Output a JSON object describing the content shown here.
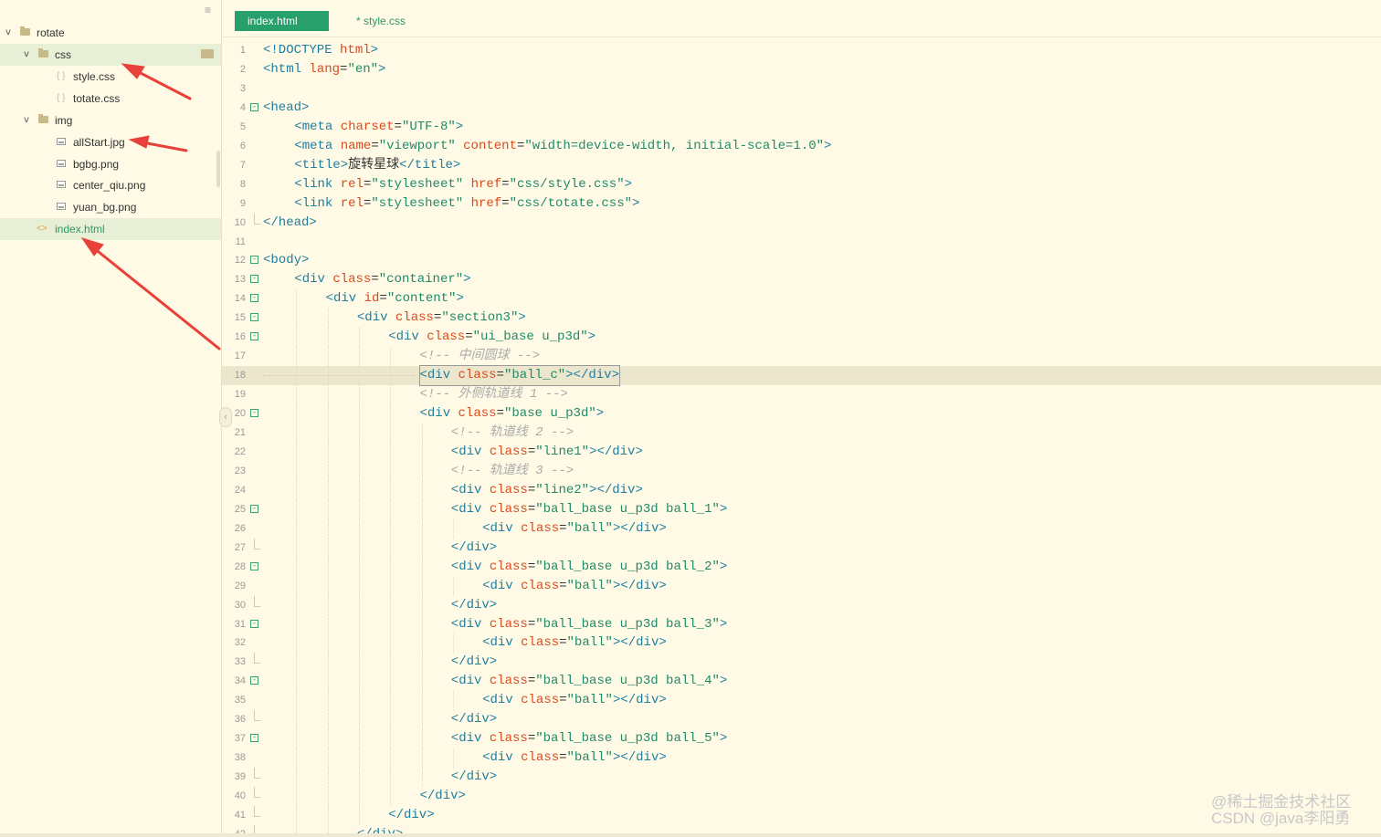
{
  "sidebar": {
    "items": [
      {
        "label": "rotate",
        "kind": "folder",
        "expanded": true
      },
      {
        "label": "css",
        "kind": "folder",
        "expanded": true,
        "selected": true
      },
      {
        "label": "style.css",
        "kind": "css-file"
      },
      {
        "label": "totate.css",
        "kind": "css-file"
      },
      {
        "label": "img",
        "kind": "folder",
        "expanded": true
      },
      {
        "label": "allStart.jpg",
        "kind": "image-file"
      },
      {
        "label": "bgbg.png",
        "kind": "image-file"
      },
      {
        "label": "center_qiu.png",
        "kind": "image-file"
      },
      {
        "label": "yuan_bg.png",
        "kind": "image-file"
      },
      {
        "label": "index.html",
        "kind": "html-file",
        "active": true
      }
    ]
  },
  "tabs": [
    {
      "label": "index.html",
      "active": true
    },
    {
      "label": "* style.css",
      "active": false
    }
  ],
  "editor": {
    "current_line": 18,
    "lines": [
      {
        "n": "1",
        "code": [
          [
            "t",
            "<!DOCTYPE "
          ],
          [
            "a",
            "html"
          ],
          [
            "t",
            ">"
          ]
        ]
      },
      {
        "n": "2",
        "code": [
          [
            "t",
            "<html "
          ],
          [
            "a",
            "lang"
          ],
          [
            "p",
            "="
          ],
          [
            "s",
            "\"en\""
          ],
          [
            "t",
            ">"
          ]
        ]
      },
      {
        "n": "3",
        "code": []
      },
      {
        "n": "4",
        "fold": true,
        "code": [
          [
            "t",
            "<head>"
          ]
        ]
      },
      {
        "n": "5",
        "code": [
          [
            "t",
            "<meta "
          ],
          [
            "a",
            "charset"
          ],
          [
            "p",
            "="
          ],
          [
            "s",
            "\"UTF-8\""
          ],
          [
            "t",
            ">"
          ]
        ]
      },
      {
        "n": "6",
        "code": [
          [
            "t",
            "<meta "
          ],
          [
            "a",
            "name"
          ],
          [
            "p",
            "="
          ],
          [
            "s",
            "\"viewport\" "
          ],
          [
            "a",
            "content"
          ],
          [
            "p",
            "="
          ],
          [
            "s",
            "\"width=device-width, initial-scale=1.0\""
          ],
          [
            "t",
            ">"
          ]
        ]
      },
      {
        "n": "7",
        "code": [
          [
            "t",
            "<title>"
          ],
          [
            "p",
            "旋转星球"
          ],
          [
            "t",
            "</title>"
          ]
        ]
      },
      {
        "n": "8",
        "code": [
          [
            "t",
            "<link "
          ],
          [
            "a",
            "rel"
          ],
          [
            "p",
            "="
          ],
          [
            "s",
            "\"stylesheet\" "
          ],
          [
            "a",
            "href"
          ],
          [
            "p",
            "="
          ],
          [
            "s",
            "\"css/style.css\""
          ],
          [
            "t",
            ">"
          ]
        ]
      },
      {
        "n": "9",
        "code": [
          [
            "t",
            "<link "
          ],
          [
            "a",
            "rel"
          ],
          [
            "p",
            "="
          ],
          [
            "s",
            "\"stylesheet\" "
          ],
          [
            "a",
            "href"
          ],
          [
            "p",
            "="
          ],
          [
            "s",
            "\"css/totate.css\""
          ],
          [
            "t",
            ">"
          ]
        ]
      },
      {
        "n": "10",
        "foldEnd": true,
        "code": [
          [
            "t",
            "</head>"
          ]
        ]
      },
      {
        "n": "11",
        "code": []
      },
      {
        "n": "12",
        "fold": true,
        "code": [
          [
            "t",
            "<body>"
          ]
        ]
      },
      {
        "n": "13",
        "fold": true,
        "code": [
          [
            "t",
            "<div "
          ],
          [
            "a",
            "class"
          ],
          [
            "p",
            "="
          ],
          [
            "s",
            "\"container\""
          ],
          [
            "t",
            ">"
          ]
        ]
      },
      {
        "n": "14",
        "fold": true,
        "code": [
          [
            "t",
            "<div "
          ],
          [
            "a",
            "id"
          ],
          [
            "p",
            "="
          ],
          [
            "s",
            "\"content\""
          ],
          [
            "t",
            ">"
          ]
        ]
      },
      {
        "n": "15",
        "fold": true,
        "code": [
          [
            "t",
            "<div "
          ],
          [
            "a",
            "class"
          ],
          [
            "p",
            "="
          ],
          [
            "s",
            "\"section3\""
          ],
          [
            "t",
            ">"
          ]
        ]
      },
      {
        "n": "16",
        "fold": true,
        "code": [
          [
            "t",
            "<div "
          ],
          [
            "a",
            "class"
          ],
          [
            "p",
            "="
          ],
          [
            "s",
            "\"ui_base u_p3d\""
          ],
          [
            "t",
            ">"
          ]
        ]
      },
      {
        "n": "17",
        "code": [
          [
            "c",
            "<!-- 中间圆球 -->"
          ]
        ]
      },
      {
        "n": "18",
        "code": [
          [
            "t",
            "<div "
          ],
          [
            "a",
            "class"
          ],
          [
            "p",
            "="
          ],
          [
            "s",
            "\"ball_c\""
          ],
          [
            "t",
            "></div>"
          ]
        ]
      },
      {
        "n": "19",
        "code": [
          [
            "c",
            "<!-- 外侧轨道线 1 -->"
          ]
        ]
      },
      {
        "n": "20",
        "fold": true,
        "code": [
          [
            "t",
            "<div "
          ],
          [
            "a",
            "class"
          ],
          [
            "p",
            "="
          ],
          [
            "s",
            "\"base u_p3d\""
          ],
          [
            "t",
            ">"
          ]
        ]
      },
      {
        "n": "21",
        "code": [
          [
            "c",
            "<!-- 轨道线 2 -->"
          ]
        ]
      },
      {
        "n": "22",
        "code": [
          [
            "t",
            "<div "
          ],
          [
            "a",
            "class"
          ],
          [
            "p",
            "="
          ],
          [
            "s",
            "\"line1\""
          ],
          [
            "t",
            "></div>"
          ]
        ]
      },
      {
        "n": "23",
        "code": [
          [
            "c",
            "<!-- 轨道线 3 -->"
          ]
        ]
      },
      {
        "n": "24",
        "code": [
          [
            "t",
            "<div "
          ],
          [
            "a",
            "class"
          ],
          [
            "p",
            "="
          ],
          [
            "s",
            "\"line2\""
          ],
          [
            "t",
            "></div>"
          ]
        ]
      },
      {
        "n": "25",
        "fold": true,
        "code": [
          [
            "t",
            "<div "
          ],
          [
            "a",
            "class"
          ],
          [
            "p",
            "="
          ],
          [
            "s",
            "\"ball_base u_p3d ball_1\""
          ],
          [
            "t",
            ">"
          ]
        ]
      },
      {
        "n": "26",
        "code": [
          [
            "t",
            "<div "
          ],
          [
            "a",
            "class"
          ],
          [
            "p",
            "="
          ],
          [
            "s",
            "\"ball\""
          ],
          [
            "t",
            "></div>"
          ]
        ]
      },
      {
        "n": "27",
        "foldEnd": true,
        "code": [
          [
            "t",
            "</div>"
          ]
        ]
      },
      {
        "n": "28",
        "fold": true,
        "code": [
          [
            "t",
            "<div "
          ],
          [
            "a",
            "class"
          ],
          [
            "p",
            "="
          ],
          [
            "s",
            "\"ball_base u_p3d ball_2\""
          ],
          [
            "t",
            ">"
          ]
        ]
      },
      {
        "n": "29",
        "code": [
          [
            "t",
            "<div "
          ],
          [
            "a",
            "class"
          ],
          [
            "p",
            "="
          ],
          [
            "s",
            "\"ball\""
          ],
          [
            "t",
            "></div>"
          ]
        ]
      },
      {
        "n": "30",
        "foldEnd": true,
        "code": [
          [
            "t",
            "</div>"
          ]
        ]
      },
      {
        "n": "31",
        "fold": true,
        "code": [
          [
            "t",
            "<div "
          ],
          [
            "a",
            "class"
          ],
          [
            "p",
            "="
          ],
          [
            "s",
            "\"ball_base u_p3d ball_3\""
          ],
          [
            "t",
            ">"
          ]
        ]
      },
      {
        "n": "32",
        "code": [
          [
            "t",
            "<div "
          ],
          [
            "a",
            "class"
          ],
          [
            "p",
            "="
          ],
          [
            "s",
            "\"ball\""
          ],
          [
            "t",
            "></div>"
          ]
        ]
      },
      {
        "n": "33",
        "foldEnd": true,
        "code": [
          [
            "t",
            "</div>"
          ]
        ]
      },
      {
        "n": "34",
        "fold": true,
        "code": [
          [
            "t",
            "<div "
          ],
          [
            "a",
            "class"
          ],
          [
            "p",
            "="
          ],
          [
            "s",
            "\"ball_base u_p3d ball_4\""
          ],
          [
            "t",
            ">"
          ]
        ]
      },
      {
        "n": "35",
        "code": [
          [
            "t",
            "<div "
          ],
          [
            "a",
            "class"
          ],
          [
            "p",
            "="
          ],
          [
            "s",
            "\"ball\""
          ],
          [
            "t",
            "></div>"
          ]
        ]
      },
      {
        "n": "36",
        "foldEnd": true,
        "code": [
          [
            "t",
            "</div>"
          ]
        ]
      },
      {
        "n": "37",
        "fold": true,
        "code": [
          [
            "t",
            "<div "
          ],
          [
            "a",
            "class"
          ],
          [
            "p",
            "="
          ],
          [
            "s",
            "\"ball_base u_p3d ball_5\""
          ],
          [
            "t",
            ">"
          ]
        ]
      },
      {
        "n": "38",
        "code": [
          [
            "t",
            "<div "
          ],
          [
            "a",
            "class"
          ],
          [
            "p",
            "="
          ],
          [
            "s",
            "\"ball\""
          ],
          [
            "t",
            "></div>"
          ]
        ]
      },
      {
        "n": "39",
        "foldEnd": true,
        "code": [
          [
            "t",
            "</div>"
          ]
        ]
      },
      {
        "n": "40",
        "foldEnd": true,
        "code": [
          [
            "t",
            "</div>"
          ]
        ]
      },
      {
        "n": "41",
        "foldEnd": true,
        "code": [
          [
            "t",
            "</div>"
          ]
        ]
      },
      {
        "n": "42",
        "foldEnd": true,
        "code": [
          [
            "t",
            "</div>"
          ]
        ]
      }
    ]
  },
  "watermark": {
    "line1": "@稀土掘金技术社区",
    "line2": "CSDN @java李阳勇"
  },
  "colors": {
    "background": "#fffae6",
    "tab_active": "#27a06c",
    "tag": "#1f7d9e",
    "attribute": "#d94a1c",
    "string": "#1f8a69",
    "annotation_arrow": "#e8413a"
  }
}
